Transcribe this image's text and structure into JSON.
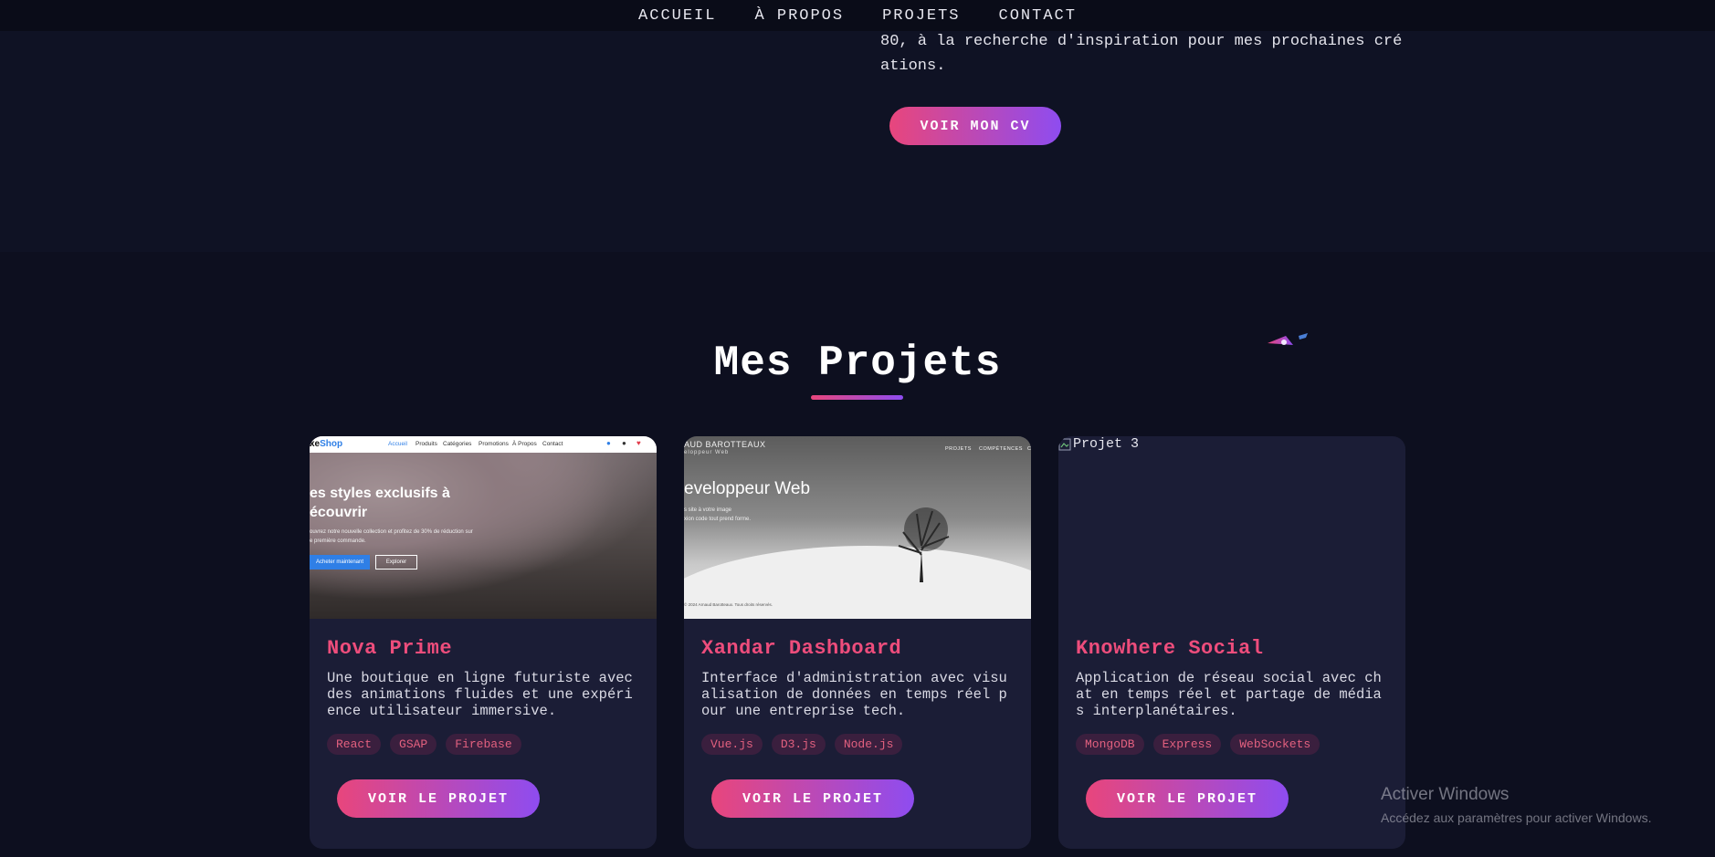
{
  "nav": {
    "items": [
      "ACCUEIL",
      "À PROPOS",
      "PROJETS",
      "CONTACT"
    ]
  },
  "about": {
    "text_visible": "80, à la recherche d'inspiration pour mes prochaines créations.",
    "cv_button": "VOIR MON CV"
  },
  "projects": {
    "title": "Mes Projets",
    "cards": [
      {
        "title": "Nova Prime",
        "description": "Une boutique en ligne futuriste avec des animations fluides et une expérience utilisateur immersive.",
        "tags": [
          "React",
          "GSAP",
          "Firebase"
        ],
        "button": "VOIR LE PROJET",
        "thumbnail": {
          "logo_a": "xe",
          "logo_b": "Shop",
          "nav": [
            "Accueil",
            "Produits",
            "Catégories",
            "Promotions",
            "À Propos",
            "Contact"
          ],
          "heading": "es styles exclusifs à\nécouvrir",
          "text": "ouvrez notre nouvelle collection et profitez de 30% de réduction sur\ne première commande.",
          "primary_btn": "Acheter maintenant",
          "secondary_btn": "Explorer"
        }
      },
      {
        "title": "Xandar Dashboard",
        "description": "Interface d'administration avec visualisation de données en temps réel pour une entreprise tech.",
        "tags": [
          "Vue.js",
          "D3.js",
          "Node.js"
        ],
        "button": "VOIR LE PROJET",
        "thumbnail": {
          "name": "AUD BAROTTEAUX",
          "sub": "eloppeur Web",
          "nav": [
            "PROJETS",
            "COMPÉTENCES",
            "C"
          ],
          "heading": "eveloppeur Web",
          "text": "s site à votre image\nxion code tout prend forme.",
          "footer": "© 2024 Arnaud Barotteaux. Tous droits réservés."
        }
      },
      {
        "title": "Knowhere Social",
        "description": "Application de réseau social avec chat en temps réel et partage de médias interplanétaires.",
        "tags": [
          "MongoDB",
          "Express",
          "WebSockets"
        ],
        "button": "VOIR LE PROJET",
        "image_alt": "Projet 3"
      }
    ]
  },
  "watermark": {
    "title": "Activer Windows",
    "subtitle": "Accédez aux paramètres pour activer Windows."
  },
  "colors": {
    "background": "#0d0f1f",
    "card": "#1b1d36",
    "accent_pink": "#e8467c",
    "accent_purple": "#8e4cf0",
    "title_pink": "#ee4d7c"
  }
}
